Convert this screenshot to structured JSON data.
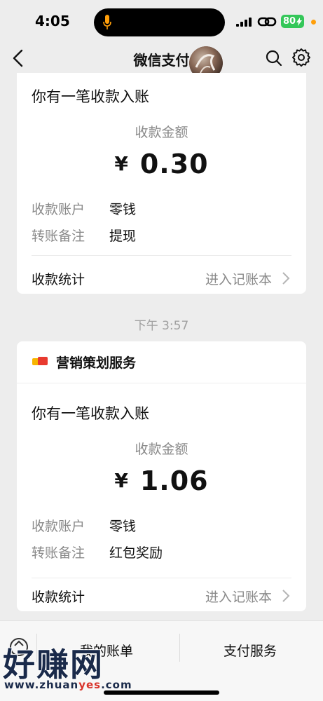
{
  "status_bar": {
    "time": "4:05",
    "battery": "80",
    "colors": {
      "battery": "#34c759",
      "dot": "#ff9f0a",
      "mic": "#ff9f0a"
    }
  },
  "nav": {
    "title": "微信支付",
    "icons": [
      "back-arrow-icon",
      "search-icon",
      "gear-icon"
    ]
  },
  "card1": {
    "headline": "你有一笔收款入账",
    "amount_label": "收款金额",
    "currency": "¥",
    "amount": "0.30",
    "rows": [
      {
        "key": "收款账户",
        "value": "零钱"
      },
      {
        "key": "转账备注",
        "value": "提现"
      }
    ],
    "stat_label": "收款统计",
    "stat_link": "进入记账本"
  },
  "timestamp": "下午 3:57",
  "card2": {
    "sender": "营销策划服务",
    "headline": "你有一笔收款入账",
    "amount_label": "收款金额",
    "currency": "¥",
    "amount": "1.06",
    "rows": [
      {
        "key": "收款账户",
        "value": "零钱"
      },
      {
        "key": "转账备注",
        "value": "红包奖励"
      }
    ],
    "stat_label": "收款统计",
    "stat_link": "进入记账本"
  },
  "bottom_bar": {
    "items": [
      "我的账单",
      "支付服务"
    ]
  },
  "watermark": {
    "brand": "好赚网",
    "url_prefix": "www.zhuan",
    "url_highlight": "yes",
    "url_suffix": ".com"
  }
}
